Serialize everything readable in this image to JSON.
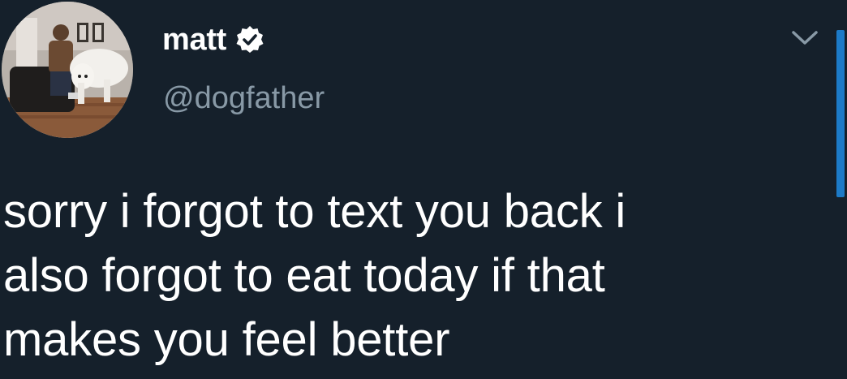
{
  "tweet": {
    "display_name": "matt",
    "handle": "@dogfather",
    "verified": true,
    "text_lines": [
      "sorry i forgot to text you back i",
      "also forgot to eat today if that",
      "makes you feel better"
    ]
  },
  "icons": {
    "verified": "verified-badge-icon",
    "menu": "chevron-down-icon"
  },
  "colors": {
    "background": "#15202b",
    "text": "#ffffff",
    "secondary_text": "#8899a6",
    "accent": "#1c7ac7"
  }
}
